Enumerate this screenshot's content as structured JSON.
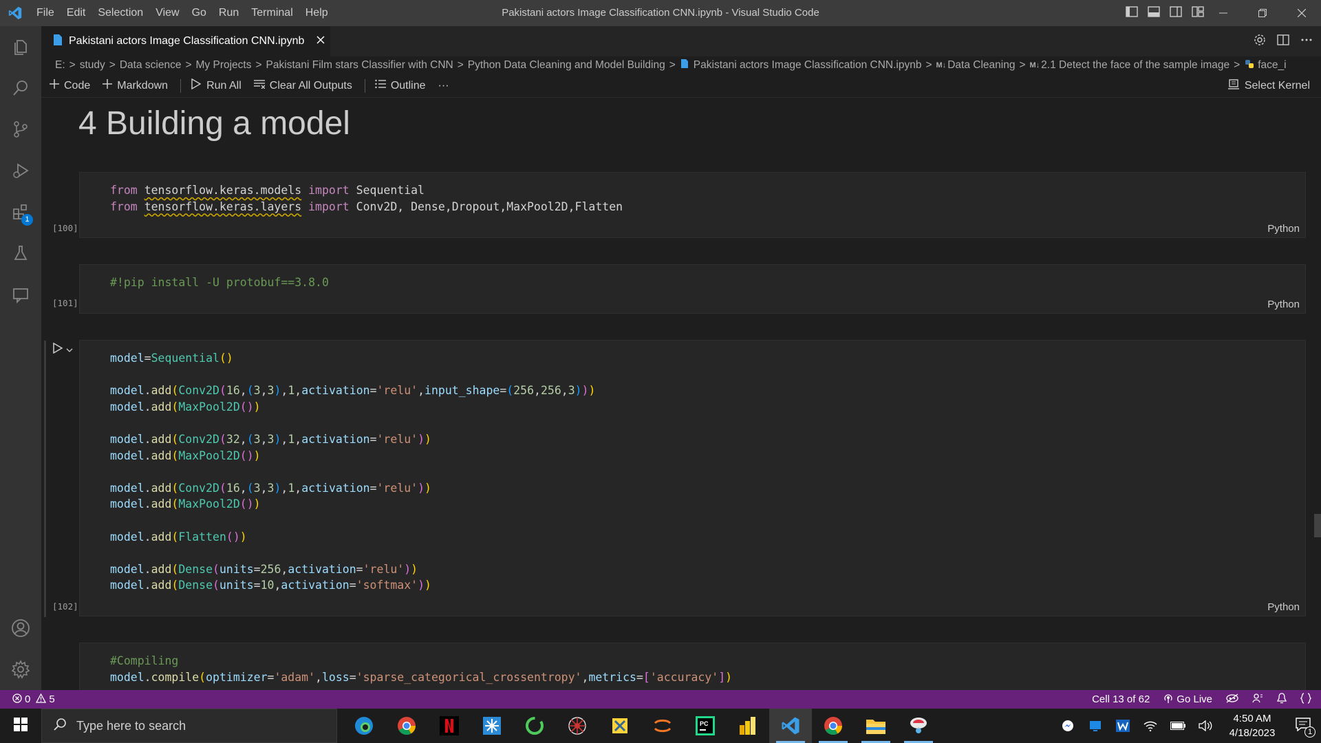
{
  "titlebar": {
    "menu": [
      "File",
      "Edit",
      "Selection",
      "View",
      "Go",
      "Run",
      "Terminal",
      "Help"
    ],
    "window_title": "Pakistani actors Image Classification CNN.ipynb - Visual Studio Code"
  },
  "activitybar": {
    "extensions_badge": "1"
  },
  "tab": {
    "title": "Pakistani actors Image Classification CNN.ipynb"
  },
  "breadcrumb": {
    "items": [
      "E:",
      "study",
      "Data science",
      "My Projects",
      "Pakistani Film stars Classifier with CNN",
      "Python Data Cleaning and Model Building",
      "Pakistani actors Image Classification CNN.ipynb",
      "Data Cleaning",
      "2.1 Detect the face of the sample image",
      "face_i"
    ]
  },
  "toolbar": {
    "code": "Code",
    "markdown": "Markdown",
    "run_all": "Run All",
    "clear_outputs": "Clear All Outputs",
    "outline": "Outline",
    "more": "···",
    "select_kernel": "Select Kernel"
  },
  "notebook": {
    "heading": "4 Building a model",
    "cells": [
      {
        "exec": "[100]",
        "lang": "Python"
      },
      {
        "exec": "[101]",
        "lang": "Python"
      },
      {
        "exec": "[102]",
        "lang": "Python"
      },
      {
        "exec": "",
        "lang": ""
      }
    ]
  },
  "statusbar": {
    "errors": "0",
    "warnings": "5",
    "cell_position": "Cell 13 of 62",
    "go_live": "Go Live"
  },
  "taskbar": {
    "search_placeholder": "Type here to search",
    "time": "4:50 AM",
    "date": "4/18/2023",
    "notification_count": "1"
  },
  "colors": {
    "statusbar": "#68217a",
    "accent": "#0078d4"
  }
}
